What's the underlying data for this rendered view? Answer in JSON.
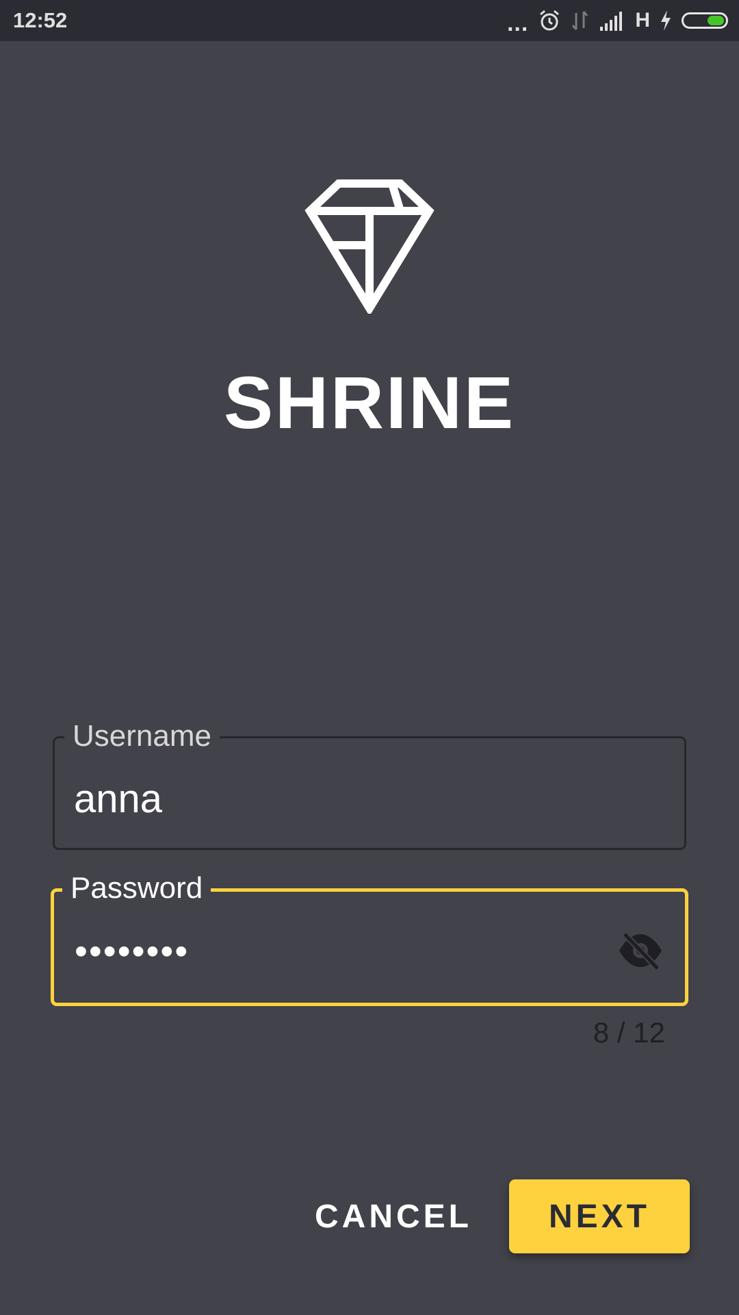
{
  "status_bar": {
    "time": "12:52",
    "dots": "...",
    "network_type": "H",
    "icons": [
      "alarm-icon",
      "data-transfer-icon",
      "signal-icon",
      "charging-icon",
      "battery-icon"
    ],
    "battery_color": "#46c42a"
  },
  "app": {
    "title": "SHRINE",
    "logo_icon": "diamond-icon"
  },
  "username": {
    "label": "Username",
    "value": "anna"
  },
  "password": {
    "label": "Password",
    "value": "••••••••",
    "toggle_icon": "visibility-off-icon",
    "counter": "8 / 12"
  },
  "actions": {
    "cancel_label": "CANCEL",
    "next_label": "NEXT"
  },
  "colors": {
    "background": "#42424a",
    "accent": "#fed23f",
    "status_bar": "#2b2b33"
  }
}
